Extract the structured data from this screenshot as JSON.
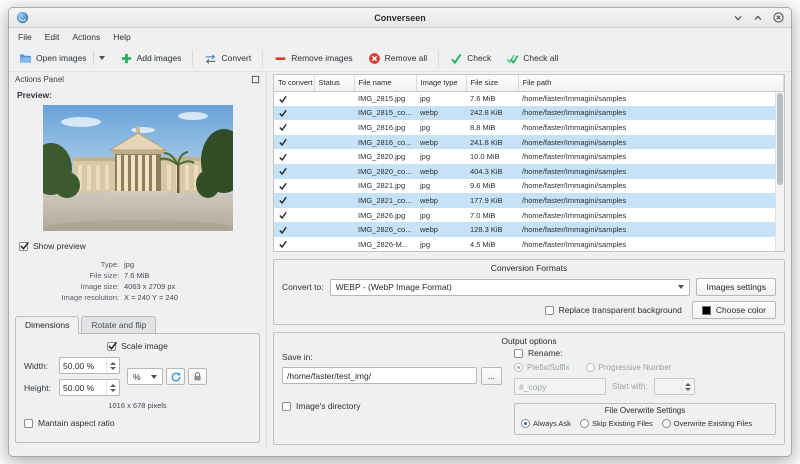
{
  "window": {
    "title": "Converseen"
  },
  "menu": {
    "items": [
      "File",
      "Edit",
      "Actions",
      "Help"
    ]
  },
  "toolbar": {
    "open": "Open images",
    "add": "Add images",
    "convert": "Convert",
    "remove": "Remove images",
    "remove_all": "Remove all",
    "check": "Check",
    "check_all": "Check all"
  },
  "dock": {
    "title": "Actions Panel",
    "preview_label": "Preview:",
    "show_preview": "Show preview",
    "info": {
      "type_label": "Type:",
      "type": "jpg",
      "size_label": "File size:",
      "size": "7.6 MiB",
      "dim_label": "Image size:",
      "dim": "4063 x 2709 px",
      "res_label": "Image resolution:",
      "res": "X = 240 Y = 240"
    },
    "tabs": {
      "dimensions": "Dimensions",
      "rotate": "Rotate and flip"
    },
    "scale_image": "Scale image",
    "width_label": "Width:",
    "width_value": "50.00 %",
    "height_label": "Height:",
    "height_value": "50.00 %",
    "unit_value": "%",
    "pixels_text": "1016 x 678 pixels",
    "aspect_label": "Mantain aspect ratio"
  },
  "table": {
    "headers": [
      "To convert",
      "Status",
      "File name",
      "Image type",
      "File size",
      "File path"
    ],
    "rows": [
      {
        "checked": true,
        "status": "",
        "name": "IMG_2815.jpg",
        "type": "jpg",
        "size": "7.6 MiB",
        "path": "/home/faster/Immagini/samples",
        "selected": false
      },
      {
        "checked": true,
        "status": "",
        "name": "IMG_2815_co...",
        "type": "webp",
        "size": "242.8 KiB",
        "path": "/home/faster/Immagini/samples",
        "selected": true
      },
      {
        "checked": true,
        "status": "",
        "name": "IMG_2816.jpg",
        "type": "jpg",
        "size": "8.8 MiB",
        "path": "/home/faster/Immagini/samples",
        "selected": false
      },
      {
        "checked": true,
        "status": "",
        "name": "IMG_2816_co...",
        "type": "webp",
        "size": "241.8 KiB",
        "path": "/home/faster/Immagini/samples",
        "selected": true
      },
      {
        "checked": true,
        "status": "",
        "name": "IMG_2820.jpg",
        "type": "jpg",
        "size": "10.0 MiB",
        "path": "/home/faster/Immagini/samples",
        "selected": false
      },
      {
        "checked": true,
        "status": "",
        "name": "IMG_2820_co...",
        "type": "webp",
        "size": "404.3 KiB",
        "path": "/home/faster/Immagini/samples",
        "selected": true
      },
      {
        "checked": true,
        "status": "",
        "name": "IMG_2821.jpg",
        "type": "jpg",
        "size": "9.6 MiB",
        "path": "/home/faster/Immagini/samples",
        "selected": false
      },
      {
        "checked": true,
        "status": "",
        "name": "IMG_2821_co...",
        "type": "webp",
        "size": "177.9 KiB",
        "path": "/home/faster/Immagini/samples",
        "selected": true
      },
      {
        "checked": true,
        "status": "",
        "name": "IMG_2826.jpg",
        "type": "jpg",
        "size": "7.0 MiB",
        "path": "/home/faster/Immagini/samples",
        "selected": false
      },
      {
        "checked": true,
        "status": "",
        "name": "IMG_2826_co...",
        "type": "webp",
        "size": "128.3 KiB",
        "path": "/home/faster/Immagini/samples",
        "selected": true
      },
      {
        "checked": true,
        "status": "",
        "name": "IMG_2826-M...",
        "type": "jpg",
        "size": "4.5 MiB",
        "path": "/home/faster/Immagini/samples",
        "selected": false
      }
    ]
  },
  "formats": {
    "title": "Conversion Formats",
    "convert_to_label": "Convert to:",
    "format_value": "WEBP - (WebP Image Format)",
    "settings_button": "Images settings",
    "replace_label": "Replace transparent background",
    "choose_color_button": "Choose color"
  },
  "output": {
    "title": "Output options",
    "save_in_label": "Save in:",
    "save_path": "/home/faster/test_img/",
    "browse_button": "...",
    "images_dir_label": "Image's directory",
    "rename_label": "Rename:",
    "prefix_label": "Prefix/Suffix",
    "progressive_label": "Progressive Number",
    "pattern_value": "#_copy",
    "start_with_label": "Start with:",
    "overwrite": {
      "title": "File Overwrite Settings",
      "options": [
        "Always Ask",
        "Skip Existing Files",
        "Overwrite Existing Files"
      ],
      "selected": "Always Ask"
    }
  },
  "colors": {
    "accent": "#3daee9",
    "selection": "#c6e2f6",
    "chosen_color": "#000000"
  }
}
